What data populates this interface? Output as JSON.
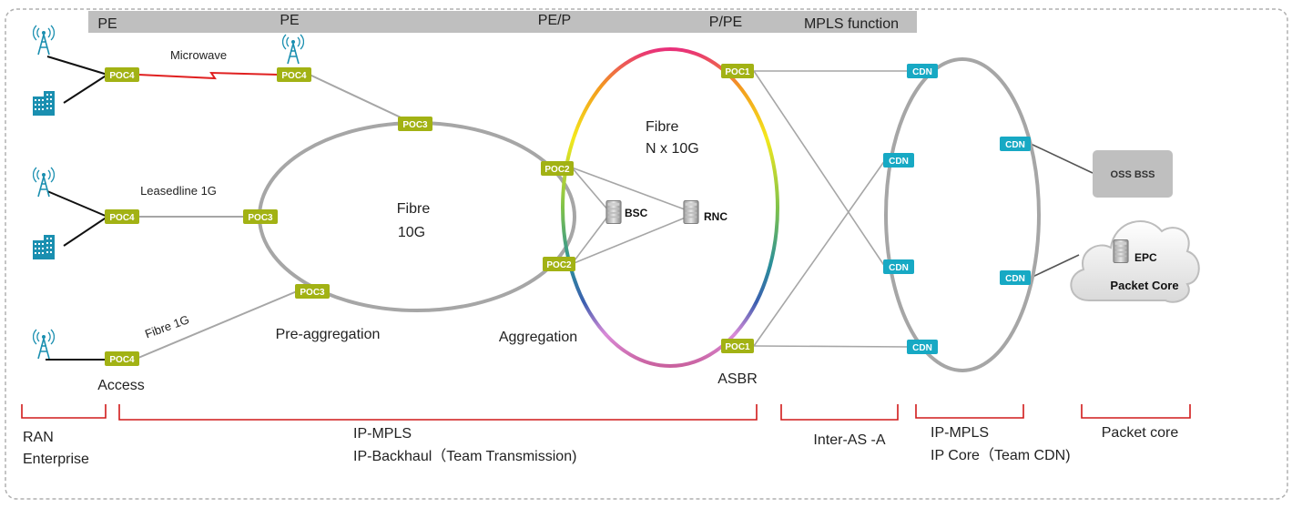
{
  "banner": {
    "roles": [
      "PE",
      "PE",
      "PE/P",
      "P/PE"
    ],
    "mpls_function": "MPLS function"
  },
  "links": {
    "microwave": "Microwave",
    "leasedline": "Leasedline  1G",
    "fibre_1g": "Fibre 1G"
  },
  "rings": {
    "pre_aggregation": {
      "line1": "Fibre",
      "line2": "10G",
      "label": "Pre-aggregation"
    },
    "aggregation": {
      "line1": "Fibre",
      "line2": "N x 10G",
      "label": "Aggregation"
    }
  },
  "nodes": {
    "poc4": "POC4",
    "poc3": "POC3",
    "poc2": "POC2",
    "poc1": "POC1",
    "cdn": "CDN",
    "bsc": "BSC",
    "rnc": "RNC",
    "oss_bss": "OSS BSS",
    "epc": "EPC",
    "packet_core_cloud": "Packet Core"
  },
  "site_labels": {
    "access": "Access",
    "asbr": "ASBR"
  },
  "domains": {
    "ran": {
      "line1": "RAN",
      "line2": "Enterprise"
    },
    "ip_backhaul": {
      "line1": "IP-MPLS",
      "line2": "IP-Backhaul（Team Transmission)"
    },
    "inter_as": {
      "line1": "Inter-AS  -A"
    },
    "ip_core": {
      "line1": "IP-MPLS",
      "line2": "IP Core（Team CDN)"
    },
    "packet_core": {
      "line1": "Packet core"
    }
  },
  "colors": {
    "poc": "#a2b214",
    "cdn": "#17a9c4",
    "ring_gray": "#a6a6a6",
    "link_gray": "#a6a6a6",
    "microwave_red": "#e02020",
    "bracket_red": "#d11a1a",
    "banner_gray": "#bfbfbf",
    "icon_teal": "#1a8fb0"
  }
}
